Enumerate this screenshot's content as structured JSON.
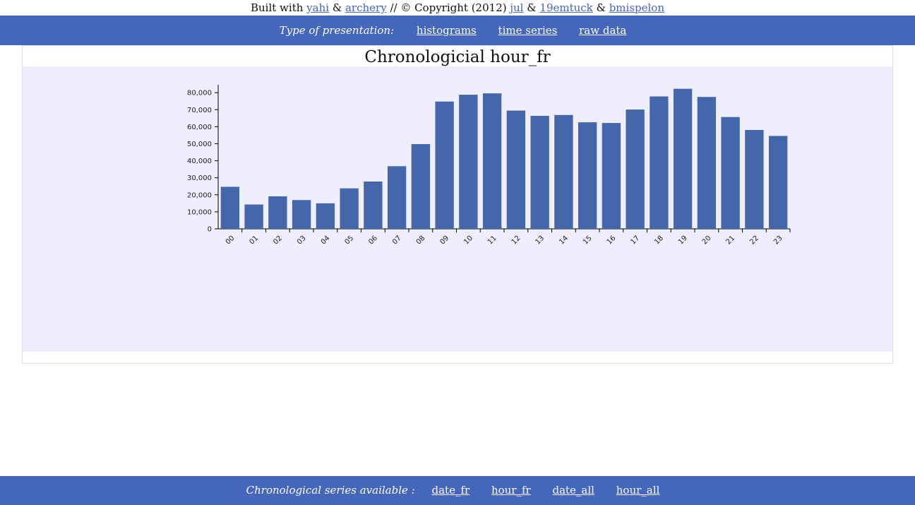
{
  "credits": {
    "prefix": "Built with",
    "links": [
      "yahi",
      "archery",
      "jul",
      "19emtuck",
      "bmispelon"
    ],
    "amp": "&",
    "copyright": "// © Copyright (2012)"
  },
  "nav": {
    "label": "Type of presentation:",
    "items": [
      "histograms",
      "time series",
      "raw data"
    ]
  },
  "footer": {
    "label": "Chronological series available :",
    "items": [
      "date_fr",
      "hour_fr",
      "date_all",
      "hour_all"
    ]
  },
  "colors": {
    "bar": "#4466aa",
    "band": "#4466bb",
    "plot_bg": "#eeeefc"
  },
  "chart_data": {
    "type": "bar",
    "title": "Chronologicial hour_fr",
    "xlabel": "",
    "ylabel": "",
    "categories": [
      "00",
      "01",
      "02",
      "03",
      "04",
      "05",
      "06",
      "07",
      "08",
      "09",
      "10",
      "11",
      "12",
      "13",
      "14",
      "15",
      "16",
      "17",
      "18",
      "19",
      "20",
      "21",
      "22",
      "23"
    ],
    "values": [
      24700,
      14300,
      19100,
      16900,
      15000,
      23800,
      27800,
      36800,
      49800,
      74800,
      78800,
      79600,
      69500,
      66400,
      66900,
      62600,
      62200,
      70100,
      77800,
      82300,
      77500,
      65700,
      58100,
      54600
    ],
    "yticks": [
      0,
      10000,
      20000,
      30000,
      40000,
      50000,
      60000,
      70000,
      80000
    ],
    "ytick_labels": [
      "0",
      "10,000",
      "20,000",
      "30,000",
      "40,000",
      "50,000",
      "60,000",
      "70,000",
      "80,000"
    ],
    "ylim": [
      0,
      83000
    ],
    "grid": false,
    "legend": "none"
  }
}
